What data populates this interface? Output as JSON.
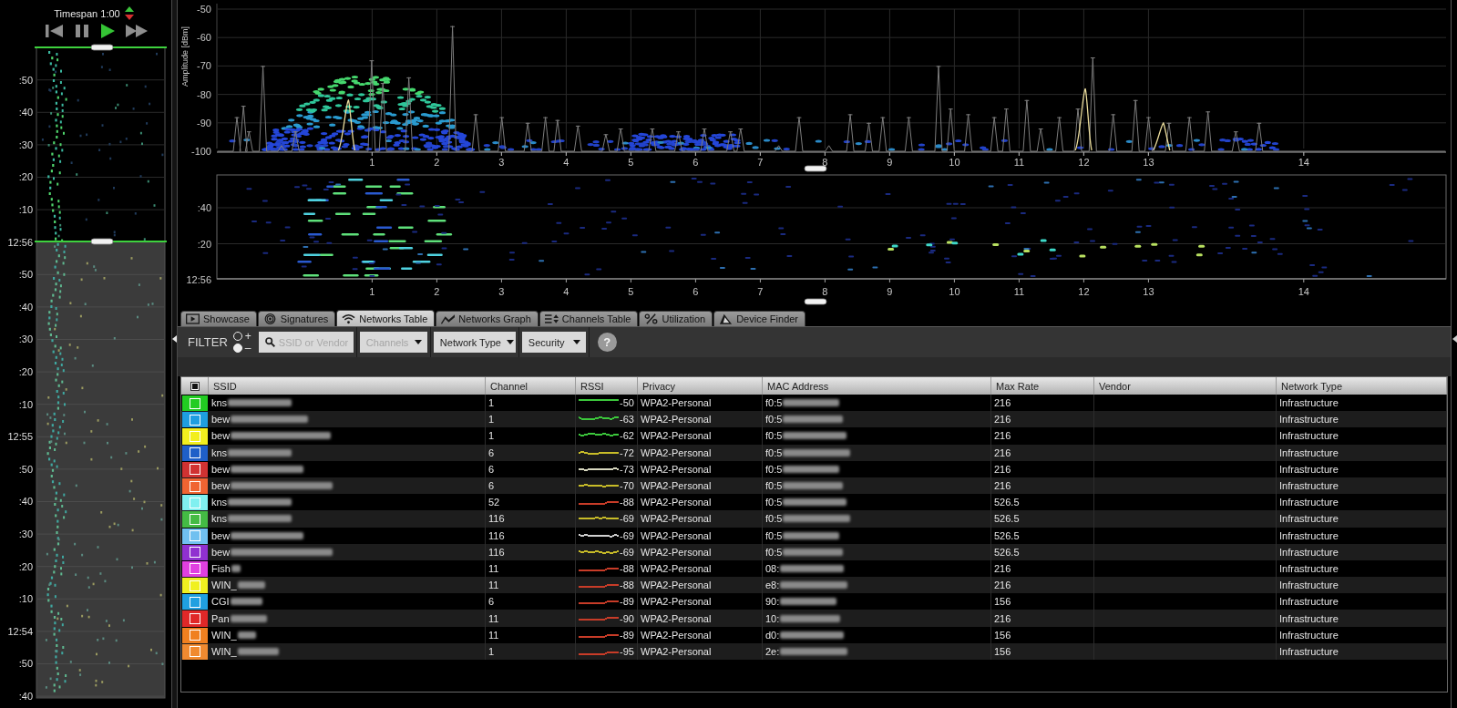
{
  "timeline": {
    "timespan": "Timespan 1:00",
    "transport": [
      {
        "kind": "skip_back",
        "active": false
      },
      {
        "kind": "pause",
        "active": false
      },
      {
        "kind": "play",
        "active": true
      },
      {
        "kind": "fast_forward",
        "active": false
      }
    ],
    "time_labels": [
      ":50",
      ":40",
      ":30",
      ":20",
      ":10",
      "12:56",
      ":50",
      ":40",
      ":30",
      ":20",
      ":10",
      "12:55",
      ":50",
      ":40",
      ":30",
      ":20",
      ":10",
      "12:54",
      ":50",
      ":40"
    ]
  },
  "spectrum": {
    "y_axis_title": "Amplitude [dBm]",
    "y_ticks": [
      "-50",
      "-60",
      "-70",
      "-80",
      "-90",
      "-100"
    ],
    "x_ticks": [
      "1",
      "2",
      "3",
      "4",
      "5",
      "6",
      "7",
      "8",
      "9",
      "10",
      "11",
      "12",
      "13",
      "14"
    ]
  },
  "waterfall": {
    "y_ticks": [
      ":40",
      ":20",
      "12:56"
    ],
    "x_ticks": [
      "1",
      "2",
      "3",
      "4",
      "5",
      "6",
      "7",
      "8",
      "9",
      "10",
      "11",
      "12",
      "13",
      "14"
    ]
  },
  "tabs": [
    {
      "label": "Showcase",
      "selected": false
    },
    {
      "label": "Signatures",
      "selected": false
    },
    {
      "label": "Networks Table",
      "selected": true
    },
    {
      "label": "Networks Graph",
      "selected": false
    },
    {
      "label": "Channels Table",
      "selected": false
    },
    {
      "label": "Utilization",
      "selected": false
    },
    {
      "label": "Device Finder",
      "selected": false
    }
  ],
  "filter": {
    "label": "FILTER",
    "modes": [
      {
        "label": "+",
        "selected": false
      },
      {
        "label": "–",
        "selected": true
      }
    ],
    "search": {
      "placeholder": "SSID or Vendor"
    },
    "dropdowns": [
      {
        "label": "Channels",
        "disabled": true
      },
      {
        "label": "Network Type",
        "disabled": false
      },
      {
        "label": "Security",
        "disabled": false
      }
    ],
    "help": "?"
  },
  "table": {
    "select_all": {
      "indeterminate": true
    },
    "columns": [
      "SSID",
      "Channel",
      "RSSI",
      "Privacy",
      "MAC Address",
      "Max Rate",
      "Vendor",
      "Network Type"
    ],
    "rows": [
      {
        "color": "#22cc22",
        "checked": false,
        "ssid": "kns",
        "channel": "1",
        "rssi": "-50",
        "trend": {
          "color": "#3cc83c"
        },
        "privacy": "WPA2-Personal",
        "mac_address": "f0:5",
        "max_rate": "216",
        "network_type": "Infrastructure"
      },
      {
        "color": "#1e9ee0",
        "checked": false,
        "ssid": "bew",
        "channel": "1",
        "rssi": "-63",
        "trend": {
          "color": "#3cc83c"
        },
        "privacy": "WPA2-Personal",
        "mac_address": "f0:5",
        "max_rate": "216",
        "network_type": "Infrastructure"
      },
      {
        "color": "#f2ee1e",
        "checked": false,
        "ssid": "bew",
        "channel": "1",
        "rssi": "-62",
        "trend": {
          "color": "#3cc83c"
        },
        "privacy": "WPA2-Personal",
        "mac_address": "f0:5",
        "max_rate": "216",
        "network_type": "Infrastructure"
      },
      {
        "color": "#1f5fc8",
        "checked": false,
        "ssid": "kns",
        "channel": "6",
        "rssi": "-72",
        "trend": {
          "color": "#c8bc28"
        },
        "privacy": "WPA2-Personal",
        "mac_address": "f0:5",
        "max_rate": "216",
        "network_type": "Infrastructure"
      },
      {
        "color": "#d03232",
        "checked": false,
        "ssid": "bew",
        "channel": "6",
        "rssi": "-73",
        "trend": {
          "color": "#d8d8c0"
        },
        "privacy": "WPA2-Personal",
        "mac_address": "f0:5",
        "max_rate": "216",
        "network_type": "Infrastructure"
      },
      {
        "color": "#f06432",
        "checked": false,
        "ssid": "bew",
        "channel": "6",
        "rssi": "-70",
        "trend": {
          "color": "#c8bc28"
        },
        "privacy": "WPA2-Personal",
        "mac_address": "f0:5",
        "max_rate": "216",
        "network_type": "Infrastructure"
      },
      {
        "color": "#80f0f0",
        "checked": false,
        "ssid": "kns",
        "channel": "52",
        "rssi": "-88",
        "trend": {
          "color": "#c83c28"
        },
        "privacy": "WPA2-Personal",
        "mac_address": "f0:5",
        "max_rate": "526.5",
        "network_type": "Infrastructure"
      },
      {
        "color": "#44bb44",
        "checked": false,
        "ssid": "kns",
        "channel": "116",
        "rssi": "-69",
        "trend": {
          "color": "#c8bc28"
        },
        "privacy": "WPA2-Personal",
        "mac_address": "f0:5",
        "max_rate": "526.5",
        "network_type": "Infrastructure"
      },
      {
        "color": "#70c0f0",
        "checked": false,
        "ssid": "bew",
        "channel": "116",
        "rssi": "-69",
        "trend": {
          "color": "#d0d0d0"
        },
        "privacy": "WPA2-Personal",
        "mac_address": "f0:5",
        "max_rate": "526.5",
        "network_type": "Infrastructure"
      },
      {
        "color": "#9030d0",
        "checked": false,
        "ssid": "bew",
        "channel": "116",
        "rssi": "-69",
        "trend": {
          "color": "#c8bc28"
        },
        "privacy": "WPA2-Personal",
        "mac_address": "f0:5",
        "max_rate": "526.5",
        "network_type": "Infrastructure"
      },
      {
        "color": "#e040e0",
        "checked": false,
        "ssid": "Fish",
        "channel": "11",
        "rssi": "-88",
        "trend": {
          "color": "#c83c28"
        },
        "privacy": "WPA2-Personal",
        "mac_address": "08:",
        "max_rate": "216",
        "network_type": "Infrastructure"
      },
      {
        "color": "#f0f020",
        "checked": false,
        "ssid": "WIN_",
        "channel": "11",
        "rssi": "-88",
        "trend": {
          "color": "#c83c28"
        },
        "privacy": "WPA2-Personal",
        "mac_address": "e8:",
        "max_rate": "216",
        "network_type": "Infrastructure"
      },
      {
        "color": "#20a0e0",
        "checked": false,
        "ssid": "CGI",
        "channel": "6",
        "rssi": "-89",
        "trend": {
          "color": "#c83c28"
        },
        "privacy": "WPA2-Personal",
        "mac_address": "90:",
        "max_rate": "156",
        "network_type": "Infrastructure"
      },
      {
        "color": "#e02828",
        "checked": false,
        "ssid": "Pan",
        "channel": "11",
        "rssi": "-90",
        "trend": {
          "color": "#c83c28"
        },
        "privacy": "WPA2-Personal",
        "mac_address": "10:",
        "max_rate": "216",
        "network_type": "Infrastructure"
      },
      {
        "color": "#f08020",
        "checked": false,
        "ssid": "WIN_",
        "channel": "11",
        "rssi": "-89",
        "trend": {
          "color": "#c83c28"
        },
        "privacy": "WPA2-Personal",
        "mac_address": "d0:",
        "max_rate": "156",
        "network_type": "Infrastructure"
      },
      {
        "color": "#f08a30",
        "checked": false,
        "ssid": "WIN_",
        "channel": "1",
        "rssi": "-95",
        "trend": {
          "color": "#c83c28"
        },
        "privacy": "WPA2-Personal",
        "mac_address": "2e:",
        "max_rate": "156",
        "network_type": "Infrastructure"
      }
    ]
  }
}
